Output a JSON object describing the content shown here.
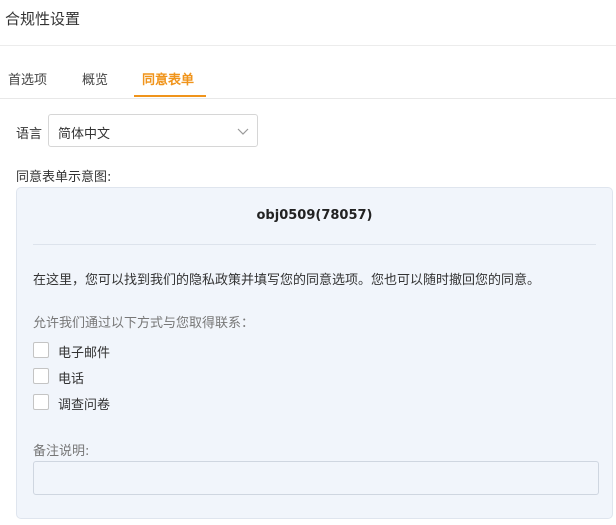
{
  "page": {
    "title": "合规性设置"
  },
  "tabs": [
    {
      "label": "首选项",
      "active": false
    },
    {
      "label": "概览",
      "active": false
    },
    {
      "label": "同意表单",
      "active": true
    }
  ],
  "language": {
    "label": "语言",
    "selected": "简体中文"
  },
  "preview": {
    "label": "同意表单示意图:",
    "title": "obj0509(78057)",
    "intro": "在这里，您可以找到我们的隐私政策并填写您的同意选项。您也可以随时撤回您的同意。",
    "contact_label": "允许我们通过以下方式与您取得联系：",
    "options": [
      {
        "label": "电子邮件",
        "checked": false
      },
      {
        "label": "电话",
        "checked": false
      },
      {
        "label": "调查问卷",
        "checked": false
      }
    ],
    "notes_label": "备注说明:",
    "notes_value": ""
  },
  "colors": {
    "accent": "#f0941b",
    "card_bg": "#f1f5fb"
  }
}
